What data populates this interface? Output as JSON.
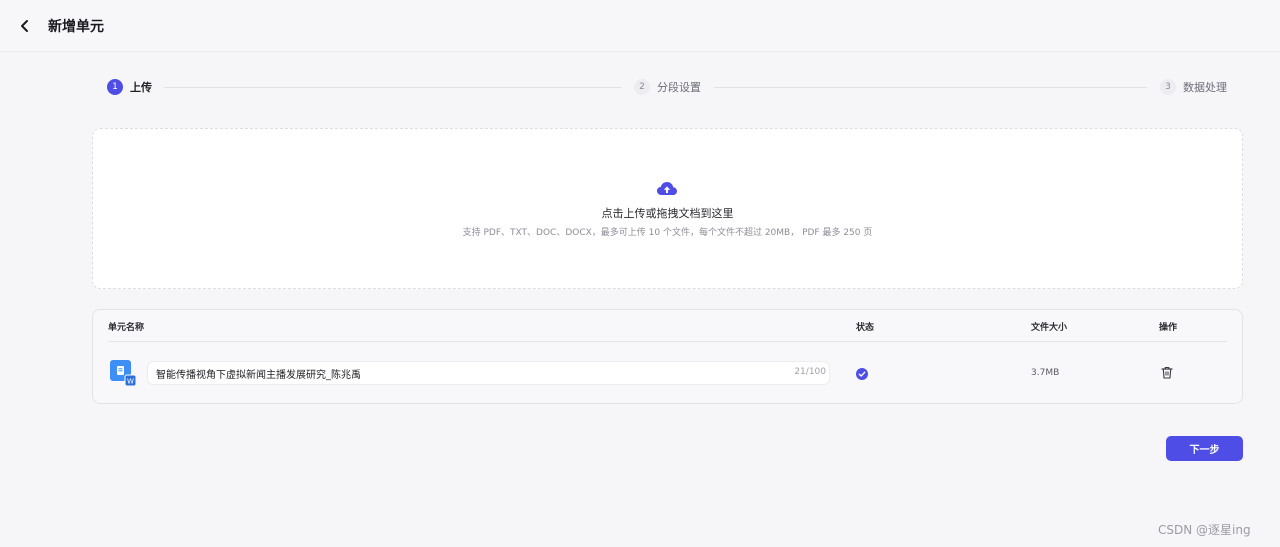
{
  "header": {
    "title": "新增单元",
    "back_icon": "chevron-left-icon"
  },
  "steps": [
    {
      "num": "1",
      "label": "上传",
      "state": "active"
    },
    {
      "num": "2",
      "label": "分段设置",
      "state": "inactive"
    },
    {
      "num": "3",
      "label": "数据处理",
      "state": "inactive"
    }
  ],
  "upload": {
    "icon": "cloud-upload-icon",
    "main_text": "点击上传或拖拽文档到这里",
    "hint_text": "支持 PDF、TXT、DOC、DOCX，最多可上传 10 个文件，每个文件不超过 20MB， PDF 最多 250 页"
  },
  "table": {
    "headers": {
      "name": "单元名称",
      "status": "状态",
      "size": "文件大小",
      "action": "操作"
    },
    "rows": [
      {
        "name": "智能传播视角下虚拟新闻主播发展研究_陈兆禹",
        "counter": "21/100",
        "status": "completed",
        "size": "3.7MB",
        "file_icon": "word-document-icon"
      }
    ]
  },
  "footer": {
    "next_label": "下一步"
  },
  "watermark": "CSDN @逐星ing",
  "colors": {
    "accent": "#4e4ee6",
    "background": "#f6f6f9"
  }
}
